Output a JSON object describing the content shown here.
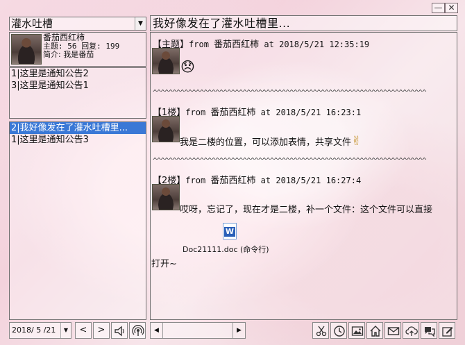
{
  "window": {
    "minimize": "—",
    "close": "✕"
  },
  "forum_select": {
    "value": "灌水吐槽"
  },
  "thread_title": "我好像发在了灌水吐槽里...",
  "user": {
    "name": "番茄西红柿",
    "stats": "主题: 56 回复: 199",
    "intro": "简介: 我是番茄"
  },
  "notices": [
    {
      "no": "1",
      "title": "这里是通知公告2"
    },
    {
      "no": "3",
      "title": "这里是通知公告1"
    }
  ],
  "threads": [
    {
      "no": "2",
      "title": "我好像发在了灌水吐槽里...",
      "selected": true
    },
    {
      "no": "1",
      "title": "这里是通知公告3",
      "selected": false
    }
  ],
  "posts": [
    {
      "tag": "【主题】",
      "from": "from",
      "author": "番茄西红柿",
      "at": "at",
      "time": "2018/5/21 12:35:19",
      "body": "",
      "emoji": "😞"
    },
    {
      "tag": "【1楼】",
      "from": "from",
      "author": "番茄西红柿",
      "at": "at",
      "time": "2018/5/21 16:23:1",
      "body": "我是二楼的位置，可以添加表情，共享文件",
      "emoji": "✌"
    },
    {
      "tag": "【2楼】",
      "from": "from",
      "author": "番茄西红柿",
      "at": "at",
      "time": "2018/5/21 16:27:4",
      "body": "哎呀，忘记了，现在才是二楼，补一个文件：这个文件可以直接",
      "body2": "打开~"
    }
  ],
  "separator": "^^^^^^^^^^^^^^^^^^^^^^^^^^^^^^^^^^^^^^^^^^^^^^^^^^^^^^^^^^^^^^^^^^^^^^",
  "attachment": {
    "name": "Doc21111.doc",
    "note": "(命令行)",
    "icon_label": "W"
  },
  "bottom": {
    "date": "2018/ 5 /21",
    "prev": "<",
    "next": ">"
  },
  "scroll": {
    "left": "◀",
    "right": "▶"
  }
}
